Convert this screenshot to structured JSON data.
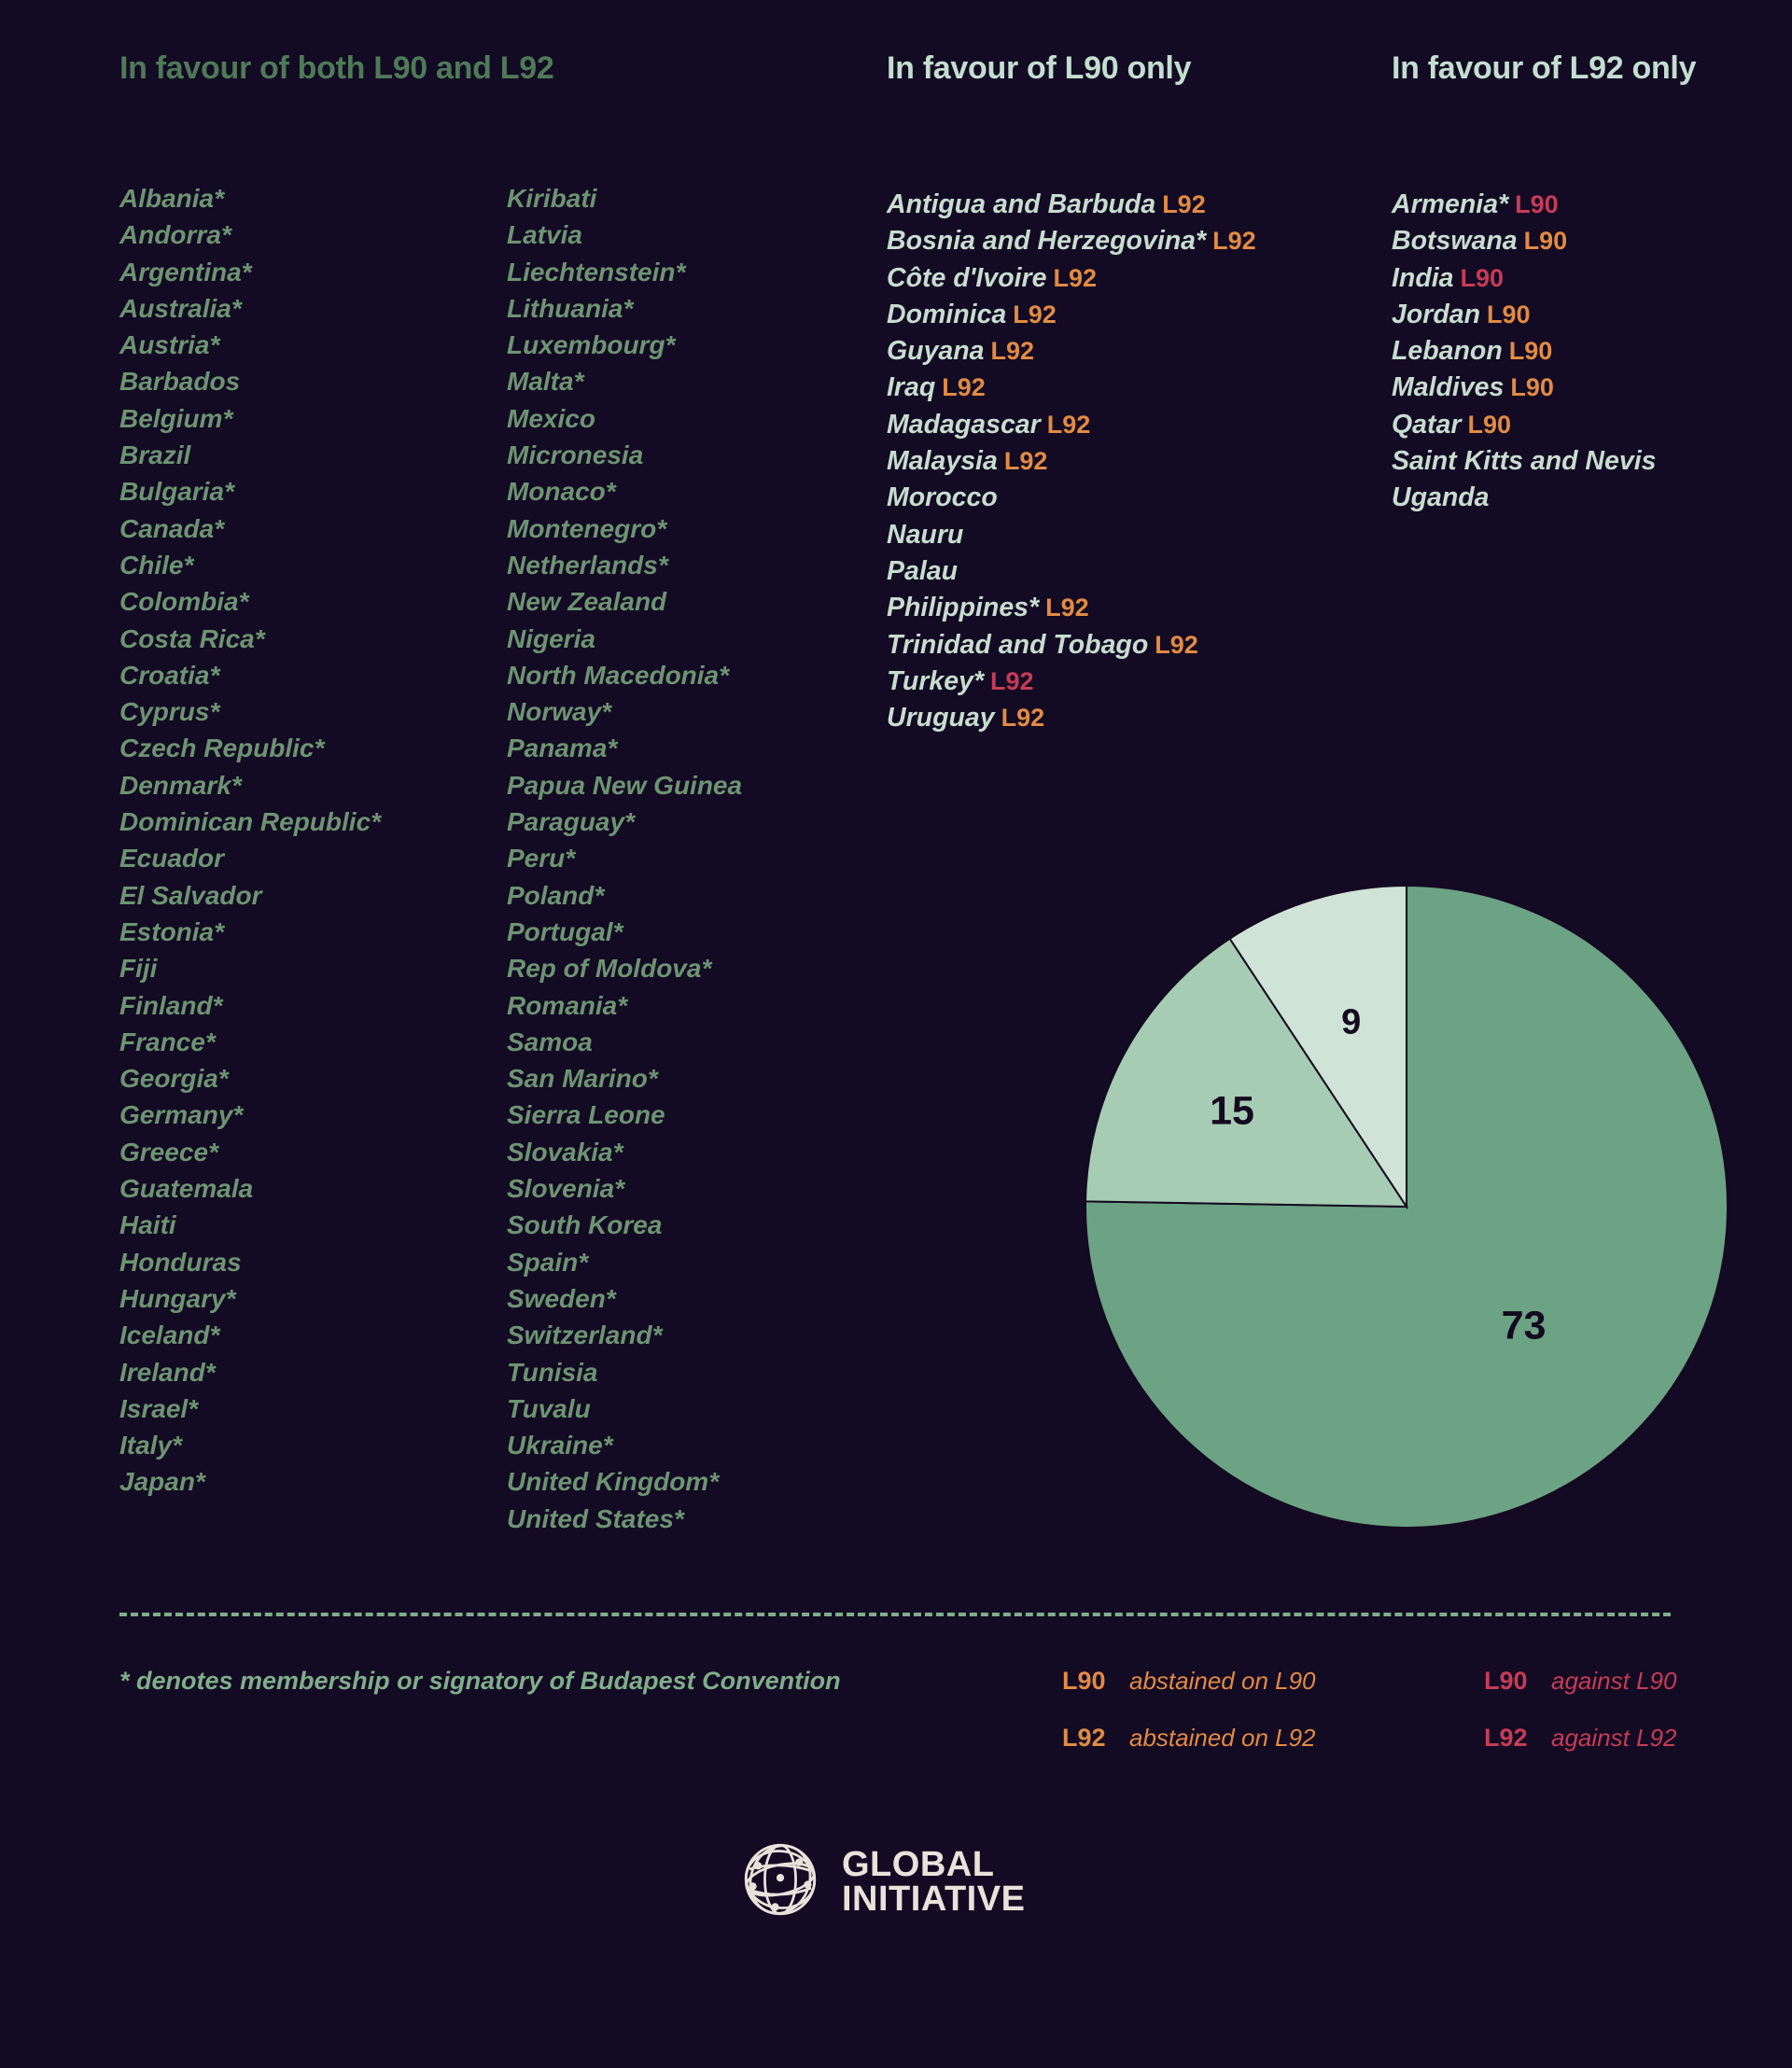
{
  "background": "#130a23",
  "colors": {
    "header_both": "#4e7a57",
    "header_only": "#c3ded0",
    "country_both": "#6d9472",
    "country_only": "#c7ddcf",
    "abstain": "#e18b43",
    "against": "#c73b57",
    "pie_73": "#6ba384",
    "pie_15": "#a6cdb4",
    "pie_9": "#cfe3d6",
    "divider": "#7fae8a",
    "logo": "#e8e3da"
  },
  "headers": {
    "both": "In favour of both L90 and L92",
    "l90_only": "In favour of L90 only",
    "l92_only": "In favour of L92 only"
  },
  "both_column_a": [
    "Albania*",
    "Andorra*",
    "Argentina*",
    "Australia*",
    "Austria*",
    "Barbados",
    "Belgium*",
    "Brazil",
    "Bulgaria*",
    "Canada*",
    "Chile*",
    "Colombia*",
    "Costa Rica*",
    "Croatia*",
    "Cyprus*",
    "Czech Republic*",
    "Denmark*",
    "Dominican Republic*",
    "Ecuador",
    "El Salvador",
    "Estonia*",
    "Fiji",
    "Finland*",
    "France*",
    "Georgia*",
    "Germany*",
    "Greece*",
    "Guatemala",
    "Haiti",
    "Honduras",
    "Hungary*",
    "Iceland*",
    "Ireland*",
    "Israel*",
    "Italy*",
    "Japan*"
  ],
  "both_column_b": [
    "Kiribati",
    "Latvia",
    "Liechtenstein*",
    "Lithuania*",
    "Luxembourg*",
    "Malta*",
    "Mexico",
    "Micronesia",
    "Monaco*",
    "Montenegro*",
    "Netherlands*",
    "New Zealand",
    "Nigeria",
    "North Macedonia*",
    "Norway*",
    "Panama*",
    "Papua New Guinea",
    "Paraguay*",
    "Peru*",
    "Poland*",
    "Portugal*",
    "Rep of Moldova*",
    "Romania*",
    "Samoa",
    "San Marino*",
    "Sierra Leone",
    "Slovakia*",
    "Slovenia*",
    "South Korea",
    "Spain*",
    "Sweden*",
    "Switzerland*",
    "Tunisia",
    "Tuvalu",
    "Ukraine*",
    "United Kingdom*",
    "United States*"
  ],
  "l90_only": [
    {
      "name": "Antigua and Barbuda",
      "tag": "L92",
      "tag_type": "abstain"
    },
    {
      "name": "Bosnia and Herzegovina*",
      "tag": "L92",
      "tag_type": "abstain"
    },
    {
      "name": "Côte d'Ivoire",
      "tag": "L92",
      "tag_type": "abstain"
    },
    {
      "name": "Dominica",
      "tag": "L92",
      "tag_type": "abstain"
    },
    {
      "name": "Guyana",
      "tag": "L92",
      "tag_type": "abstain"
    },
    {
      "name": "Iraq",
      "tag": "L92",
      "tag_type": "abstain"
    },
    {
      "name": "Madagascar",
      "tag": "L92",
      "tag_type": "abstain"
    },
    {
      "name": "Malaysia",
      "tag": "L92",
      "tag_type": "abstain"
    },
    {
      "name": "Morocco",
      "tag": "",
      "tag_type": ""
    },
    {
      "name": "Nauru",
      "tag": "",
      "tag_type": ""
    },
    {
      "name": "Palau",
      "tag": "",
      "tag_type": ""
    },
    {
      "name": "Philippines*",
      "tag": "L92",
      "tag_type": "abstain"
    },
    {
      "name": "Trinidad and Tobago",
      "tag": "L92",
      "tag_type": "abstain"
    },
    {
      "name": "Turkey*",
      "tag": "L92",
      "tag_type": "against"
    },
    {
      "name": "Uruguay",
      "tag": "L92",
      "tag_type": "abstain"
    }
  ],
  "l92_only": [
    {
      "name": "Armenia*",
      "tag": "L90",
      "tag_type": "against"
    },
    {
      "name": "Botswana",
      "tag": "L90",
      "tag_type": "abstain"
    },
    {
      "name": "India",
      "tag": "L90",
      "tag_type": "against"
    },
    {
      "name": "Jordan",
      "tag": "L90",
      "tag_type": "abstain"
    },
    {
      "name": "Lebanon",
      "tag": "L90",
      "tag_type": "abstain"
    },
    {
      "name": "Maldives",
      "tag": "L90",
      "tag_type": "abstain"
    },
    {
      "name": "Qatar",
      "tag": "L90",
      "tag_type": "abstain"
    },
    {
      "name": "Saint Kitts and Nevis",
      "tag": "",
      "tag_type": ""
    },
    {
      "name": "Uganda",
      "tag": "",
      "tag_type": ""
    }
  ],
  "footnote": "* denotes membership or signatory of Budapest Convention",
  "key": {
    "abstain_l90_code": "L90",
    "abstain_l90_text": "abstained on L90",
    "abstain_l92_code": "L92",
    "abstain_l92_text": "abstained on L92",
    "against_l90_code": "L90",
    "against_l90_text": "against L90",
    "against_l92_code": "L92",
    "against_l92_text": "against L92"
  },
  "logo": {
    "line1": "GLOBAL",
    "line2": "INITIATIVE"
  },
  "chart_data": {
    "type": "pie",
    "title": "",
    "categories": [
      "In favour of both L90 and L92",
      "In favour of L90 only",
      "In favour of L92 only"
    ],
    "values": [
      73,
      15,
      9
    ],
    "labels": [
      "73",
      "15",
      "9"
    ],
    "colors": [
      "#6ba384",
      "#a6cdb4",
      "#cfe3d6"
    ],
    "total": 97,
    "start_angle_deg": 0,
    "direction": "clockwise",
    "legend": "none",
    "grid": false
  }
}
